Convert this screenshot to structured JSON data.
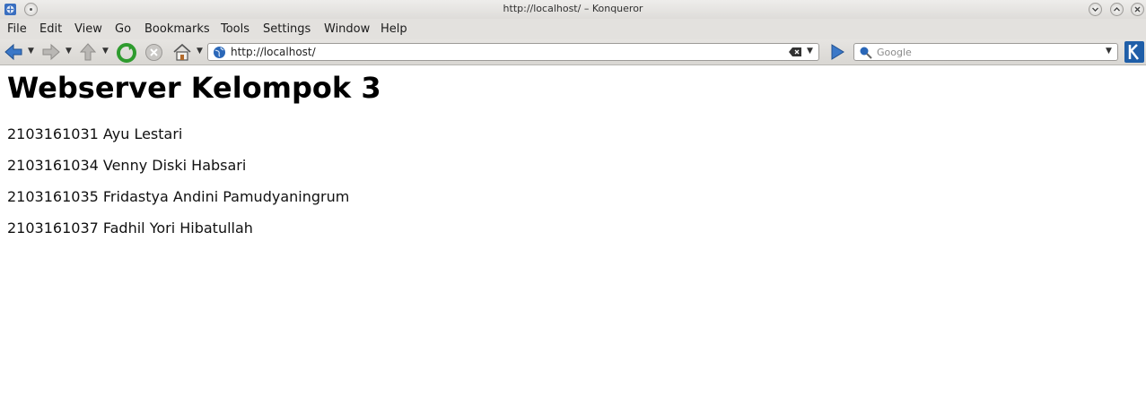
{
  "window": {
    "title": "http://localhost/ – Konqueror"
  },
  "menubar": {
    "items": [
      "File",
      "Edit",
      "View",
      "Go",
      "Bookmarks",
      "Tools",
      "Settings",
      "Window",
      "Help"
    ]
  },
  "toolbar": {
    "url": "http://localhost/",
    "search_placeholder": "Google"
  },
  "page": {
    "heading": "Webserver Kelompok 3",
    "members": [
      "2103161031 Ayu Lestari",
      "2103161034 Venny Diski Habsari",
      "2103161035 Fridastya Andini Pamudyaningrum",
      "2103161037 Fadhil Yori Hibatullah"
    ]
  },
  "colors": {
    "chrome": "#e3e1de",
    "accent_blue": "#2a67b8",
    "reload_green": "#2e9b2e"
  }
}
